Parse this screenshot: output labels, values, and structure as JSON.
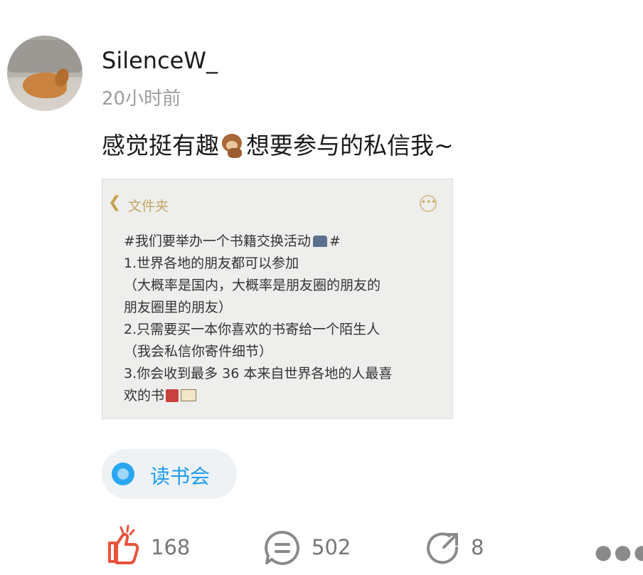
{
  "post": {
    "username": "SilenceW_",
    "time": "20小时前",
    "text_before": "感觉挺有趣",
    "text_after": "想要参与的私信我~"
  },
  "note_image": {
    "folder_label": "文件夹",
    "lines": [
      "#我们要举办一个书籍交换活动",
      "1.世界各地的朋友都可以参加",
      "（大概率是国内，大概率是朋友圈的朋友的",
      "朋友圈里的朋友）",
      "2.只需要买一本你喜欢的书寄给一个陌生人",
      "（我会私信你寄件细节）",
      "3.你会收到最多 36 本来自世界各地的人最喜",
      "欢的书"
    ],
    "hashtag_close": "#"
  },
  "topic_tag": {
    "label": "读书会",
    "color": "#1d9cf0"
  },
  "actions": {
    "likes": "168",
    "comments": "502",
    "reposts": "8"
  },
  "colors": {
    "like": "#e8533d",
    "icon_gray": "#8a8a8a"
  }
}
